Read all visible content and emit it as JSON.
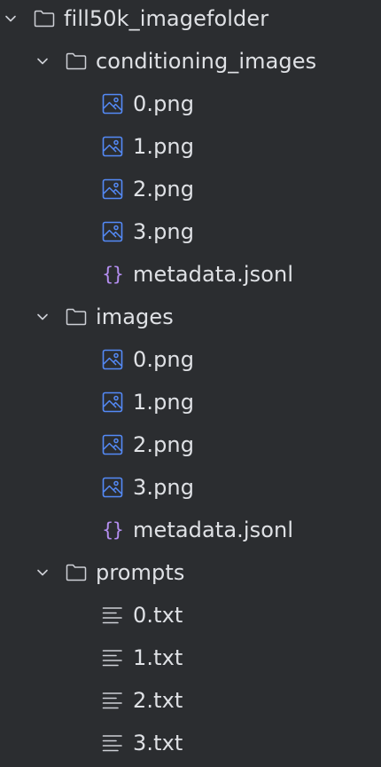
{
  "tree": {
    "root": {
      "label": "fill50k_imagefolder",
      "expanded": true
    },
    "folders": [
      {
        "label": "conditioning_images",
        "expanded": true,
        "files": [
          {
            "label": "0.png",
            "icon": "image-file-icon"
          },
          {
            "label": "1.png",
            "icon": "image-file-icon"
          },
          {
            "label": "2.png",
            "icon": "image-file-icon"
          },
          {
            "label": "3.png",
            "icon": "image-file-icon"
          },
          {
            "label": "metadata.jsonl",
            "icon": "json-file-icon"
          }
        ]
      },
      {
        "label": "images",
        "expanded": true,
        "files": [
          {
            "label": "0.png",
            "icon": "image-file-icon"
          },
          {
            "label": "1.png",
            "icon": "image-file-icon"
          },
          {
            "label": "2.png",
            "icon": "image-file-icon"
          },
          {
            "label": "3.png",
            "icon": "image-file-icon"
          },
          {
            "label": "metadata.jsonl",
            "icon": "json-file-icon"
          }
        ]
      },
      {
        "label": "prompts",
        "expanded": true,
        "files": [
          {
            "label": "0.txt",
            "icon": "text-file-icon"
          },
          {
            "label": "1.txt",
            "icon": "text-file-icon"
          },
          {
            "label": "2.txt",
            "icon": "text-file-icon"
          },
          {
            "label": "3.txt",
            "icon": "text-file-icon"
          }
        ]
      }
    ]
  },
  "colors": {
    "background": "#2b2d30",
    "text": "#dfe1e5",
    "chevron": "#ced0d6",
    "folder_stroke": "#ced0d6",
    "image_icon": "#548af7",
    "json_icon": "#b48ef0",
    "text_icon": "#ced0d6"
  }
}
